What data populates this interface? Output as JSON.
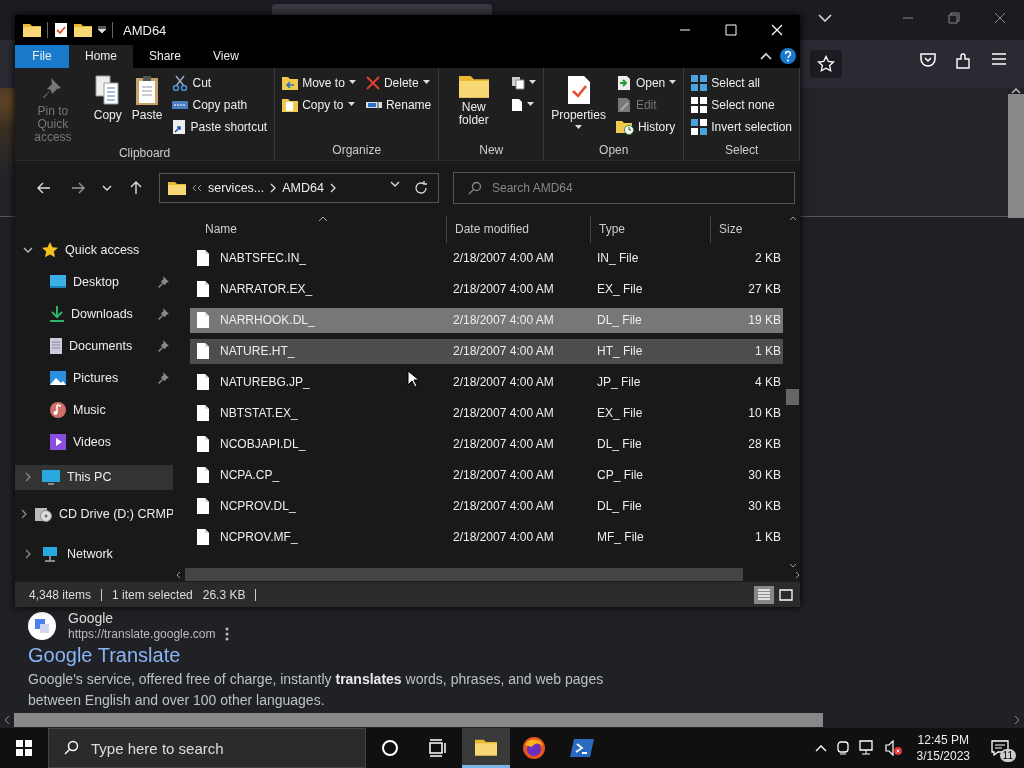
{
  "explorer": {
    "title": "AMD64",
    "tabs": [
      {
        "label": "File",
        "kind": "file",
        "selected": false
      },
      {
        "label": "Home",
        "kind": "tab",
        "selected": true
      },
      {
        "label": "Share",
        "kind": "tab",
        "selected": false
      },
      {
        "label": "View",
        "kind": "tab",
        "selected": false
      }
    ],
    "ribbon": [
      {
        "title": "Clipboard",
        "columns": [
          [
            {
              "kind": "large",
              "label": "Pin to Quick access",
              "disabled": true,
              "dropdown": false
            }
          ],
          [
            {
              "kind": "large",
              "label": "Copy",
              "disabled": false,
              "dropdown": false
            }
          ],
          [
            {
              "kind": "large",
              "label": "Paste",
              "disabled": false,
              "dropdown": false
            }
          ],
          [
            {
              "kind": "small",
              "label": "Cut",
              "disabled": false,
              "dropdown": false
            },
            {
              "kind": "small",
              "label": "Copy path",
              "disabled": false,
              "dropdown": false
            },
            {
              "kind": "small",
              "label": "Paste shortcut",
              "disabled": false,
              "dropdown": false
            }
          ]
        ]
      },
      {
        "title": "Organize",
        "columns": [
          [
            {
              "kind": "small",
              "label": "Move to",
              "disabled": false,
              "dropdown": true
            },
            {
              "kind": "small",
              "label": "Copy to",
              "disabled": false,
              "dropdown": true
            }
          ],
          [
            {
              "kind": "small",
              "label": "Delete",
              "disabled": false,
              "dropdown": true
            },
            {
              "kind": "small",
              "label": "Rename",
              "disabled": false,
              "dropdown": false
            }
          ]
        ]
      },
      {
        "title": "New",
        "columns": [
          [
            {
              "kind": "large",
              "label": "New folder",
              "disabled": false,
              "dropdown": false
            }
          ],
          [
            {
              "kind": "icon",
              "dropdown": true
            },
            {
              "kind": "icon",
              "dropdown": true
            }
          ]
        ]
      },
      {
        "title": "Open",
        "columns": [
          [
            {
              "kind": "large",
              "label": "Properties",
              "disabled": false,
              "dropdown": true
            }
          ],
          [
            {
              "kind": "small",
              "label": "Open",
              "disabled": false,
              "dropdown": true
            },
            {
              "kind": "small",
              "label": "Edit",
              "disabled": true,
              "dropdown": false
            },
            {
              "kind": "small",
              "label": "History",
              "disabled": false,
              "dropdown": false
            }
          ]
        ]
      },
      {
        "title": "Select",
        "columns": [
          [
            {
              "kind": "small",
              "label": "Select all",
              "disabled": false,
              "dropdown": false
            },
            {
              "kind": "small",
              "label": "Select none",
              "disabled": false,
              "dropdown": false
            },
            {
              "kind": "small",
              "label": "Invert selection",
              "disabled": false,
              "dropdown": false
            }
          ]
        ]
      }
    ],
    "breadcrumbs": [
      "services...",
      "AMD64"
    ],
    "search": {
      "placeholder": "Search AMD64"
    },
    "sidebar": [
      {
        "label": "Quick access",
        "expanded": true,
        "selected": false,
        "children": [
          {
            "label": "Desktop",
            "pinned": true
          },
          {
            "label": "Downloads",
            "pinned": true
          },
          {
            "label": "Documents",
            "pinned": true
          },
          {
            "label": "Pictures",
            "pinned": true
          },
          {
            "label": "Music",
            "pinned": false
          },
          {
            "label": "Videos",
            "pinned": false
          }
        ]
      },
      {
        "label": "This PC",
        "expanded": false,
        "selected": true
      },
      {
        "label": "CD Drive (D:) CRMP",
        "expanded": false,
        "selected": false
      },
      {
        "label": "Network",
        "expanded": false,
        "selected": false
      }
    ],
    "columns": [
      "Name",
      "Date modified",
      "Type",
      "Size"
    ],
    "files": [
      {
        "name": "NABTSFEC.IN_",
        "date": "2/18/2007 4:00 AM",
        "type": "IN_ File",
        "size": "2 KB",
        "selected": false,
        "hovered": false
      },
      {
        "name": "NARRATOR.EX_",
        "date": "2/18/2007 4:00 AM",
        "type": "EX_ File",
        "size": "27 KB",
        "selected": false,
        "hovered": false
      },
      {
        "name": "NARRHOOK.DL_",
        "date": "2/18/2007 4:00 AM",
        "type": "DL_ File",
        "size": "19 KB",
        "selected": true,
        "hovered": false
      },
      {
        "name": "NATURE.HT_",
        "date": "2/18/2007 4:00 AM",
        "type": "HT_ File",
        "size": "1 KB",
        "selected": false,
        "hovered": true
      },
      {
        "name": "NATUREBG.JP_",
        "date": "2/18/2007 4:00 AM",
        "type": "JP_ File",
        "size": "4 KB",
        "selected": false,
        "hovered": false
      },
      {
        "name": "NBTSTAT.EX_",
        "date": "2/18/2007 4:00 AM",
        "type": "EX_ File",
        "size": "10 KB",
        "selected": false,
        "hovered": false
      },
      {
        "name": "NCOBJAPI.DL_",
        "date": "2/18/2007 4:00 AM",
        "type": "DL_ File",
        "size": "28 KB",
        "selected": false,
        "hovered": false
      },
      {
        "name": "NCPA.CP_",
        "date": "2/18/2007 4:00 AM",
        "type": "CP_ File",
        "size": "30 KB",
        "selected": false,
        "hovered": false
      },
      {
        "name": "NCPROV.DL_",
        "date": "2/18/2007 4:00 AM",
        "type": "DL_ File",
        "size": "30 KB",
        "selected": false,
        "hovered": false
      },
      {
        "name": "NCPROV.MF_",
        "date": "2/18/2007 4:00 AM",
        "type": "MF_ File",
        "size": "1 KB",
        "selected": false,
        "hovered": false
      }
    ],
    "status": {
      "count": "4,348 items",
      "selection": "1 item selected",
      "selection_size": "26.3 KB",
      "views": [
        {
          "selected": true
        },
        {
          "selected": false
        }
      ]
    }
  },
  "search_result": {
    "site": "Google",
    "url": "https://translate.google.com",
    "title": "Google Translate",
    "snippet": "Google's service, offered free of charge, instantly **translates** words, phrases, and web pages between English and over 100 other languages."
  },
  "taskbar": {
    "search_placeholder": "Type here to search",
    "apps": [
      {
        "kind": "cortana",
        "active": false
      },
      {
        "kind": "task-view",
        "active": false
      },
      {
        "kind": "explorer",
        "active": true
      },
      {
        "kind": "browser",
        "active": false
      },
      {
        "kind": "terminal",
        "active": false
      }
    ],
    "time": "12:45 PM",
    "date": "3/15/2023",
    "notifications": "11"
  }
}
